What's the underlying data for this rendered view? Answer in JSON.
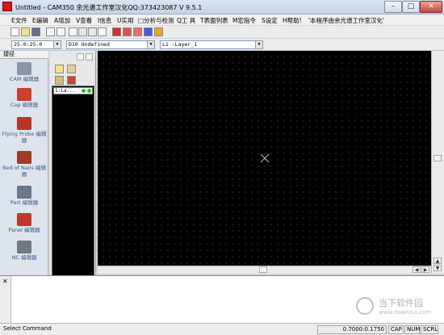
{
  "titlebar": {
    "title": "Untitled - CAM350 余光谱工作室汉化QQ:373423087 V 9.5.1",
    "minimize_glyph": "–",
    "maximize_glyph": "□",
    "close_glyph": "✕"
  },
  "menubar": {
    "items": [
      {
        "label": "E文件",
        "icon": "menu-file"
      },
      {
        "label": "E编辑",
        "icon": "menu-edit"
      },
      {
        "label": "A增加",
        "icon": "menu-add"
      },
      {
        "label": "V查看",
        "icon": "menu-view"
      },
      {
        "label": "I信息",
        "icon": "menu-info"
      },
      {
        "label": "U实用",
        "icon": "menu-utilities"
      },
      {
        "label": "□分析与检测",
        "icon": "menu-analysis"
      },
      {
        "label": "Q工 具",
        "icon": "menu-tools"
      },
      {
        "label": "T表面列表",
        "icon": "menu-tables"
      },
      {
        "label": "M宏指令",
        "icon": "menu-macro"
      },
      {
        "label": "S设定",
        "icon": "menu-settings"
      },
      {
        "label": "H帮助!",
        "icon": "menu-help"
      },
      {
        "label": "'本程序由余光谱工作室汉化'",
        "icon": "menu-credit"
      }
    ]
  },
  "toolbar": {
    "buttons": [
      "new-icon",
      "open-icon",
      "save-icon",
      "undo-icon",
      "redo-icon",
      "zoom-window-icon",
      "zoom-in-icon",
      "zoom-out-icon",
      "zoom-all-icon",
      "redraw-icon",
      "grid-icon",
      "layer-icon",
      "color-icon",
      "palette-icon"
    ]
  },
  "selectors": {
    "grid_value": "25.0:25.0",
    "dcode_value": "D10   Undefined",
    "layer_value": "L1 :Layer_1"
  },
  "left_panel": {
    "title": "捷径",
    "editors": [
      {
        "label": "CAM 编辑器",
        "icon": "cam-editor-icon",
        "color": "#8a96a8"
      },
      {
        "label": "Cap 编辑器",
        "icon": "cap-editor-icon",
        "color": "#c8402e"
      },
      {
        "label": "Flying Probe 编辑器",
        "icon": "flying-probe-icon",
        "color": "#b8342a"
      },
      {
        "label": "Bed of Nails 编辑器",
        "icon": "bed-of-nails-icon",
        "color": "#a03a2a"
      },
      {
        "label": "Part 编辑器",
        "icon": "part-editor-icon",
        "color": "#6a7888"
      },
      {
        "label": "Panel 编辑器",
        "icon": "panel-editor-icon",
        "color": "#c0382c"
      },
      {
        "label": "NC 编辑器",
        "icon": "nc-editor-icon",
        "color": "#707880"
      }
    ]
  },
  "layer_panel": {
    "layer_row": "1:La..."
  },
  "command": {
    "prompt": ""
  },
  "statusbar": {
    "message": "Select Command",
    "coords": "0.7000:0.1750",
    "caps": "CAP",
    "num": "NUM",
    "scrl": "SCRL"
  },
  "watermark": {
    "title": "当下软件园",
    "url": "www.downxia.com"
  },
  "colors": {
    "canvas": "#000000",
    "app_icon": "#d21b1b"
  }
}
